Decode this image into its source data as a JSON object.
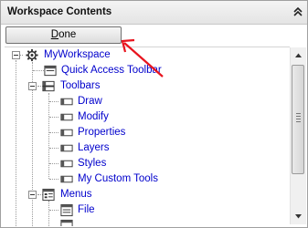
{
  "panel": {
    "title": "Workspace Contents",
    "collapse_icon": "double-chevron-up-icon"
  },
  "toolbar": {
    "done_label_prefix": "",
    "done_label_underlined": "D",
    "done_label_rest": "one"
  },
  "tree": {
    "root": "MyWorkspace",
    "quick_access": "Quick Access Toolbar",
    "toolbars": "Toolbars",
    "toolbar_items": [
      "Draw",
      "Modify",
      "Properties",
      "Layers",
      "Styles",
      "My Custom Tools"
    ],
    "menus": "Menus",
    "menu_items": [
      "File"
    ]
  },
  "colors": {
    "link_text": "#0000cc",
    "annotation_arrow": "#e8141e"
  }
}
